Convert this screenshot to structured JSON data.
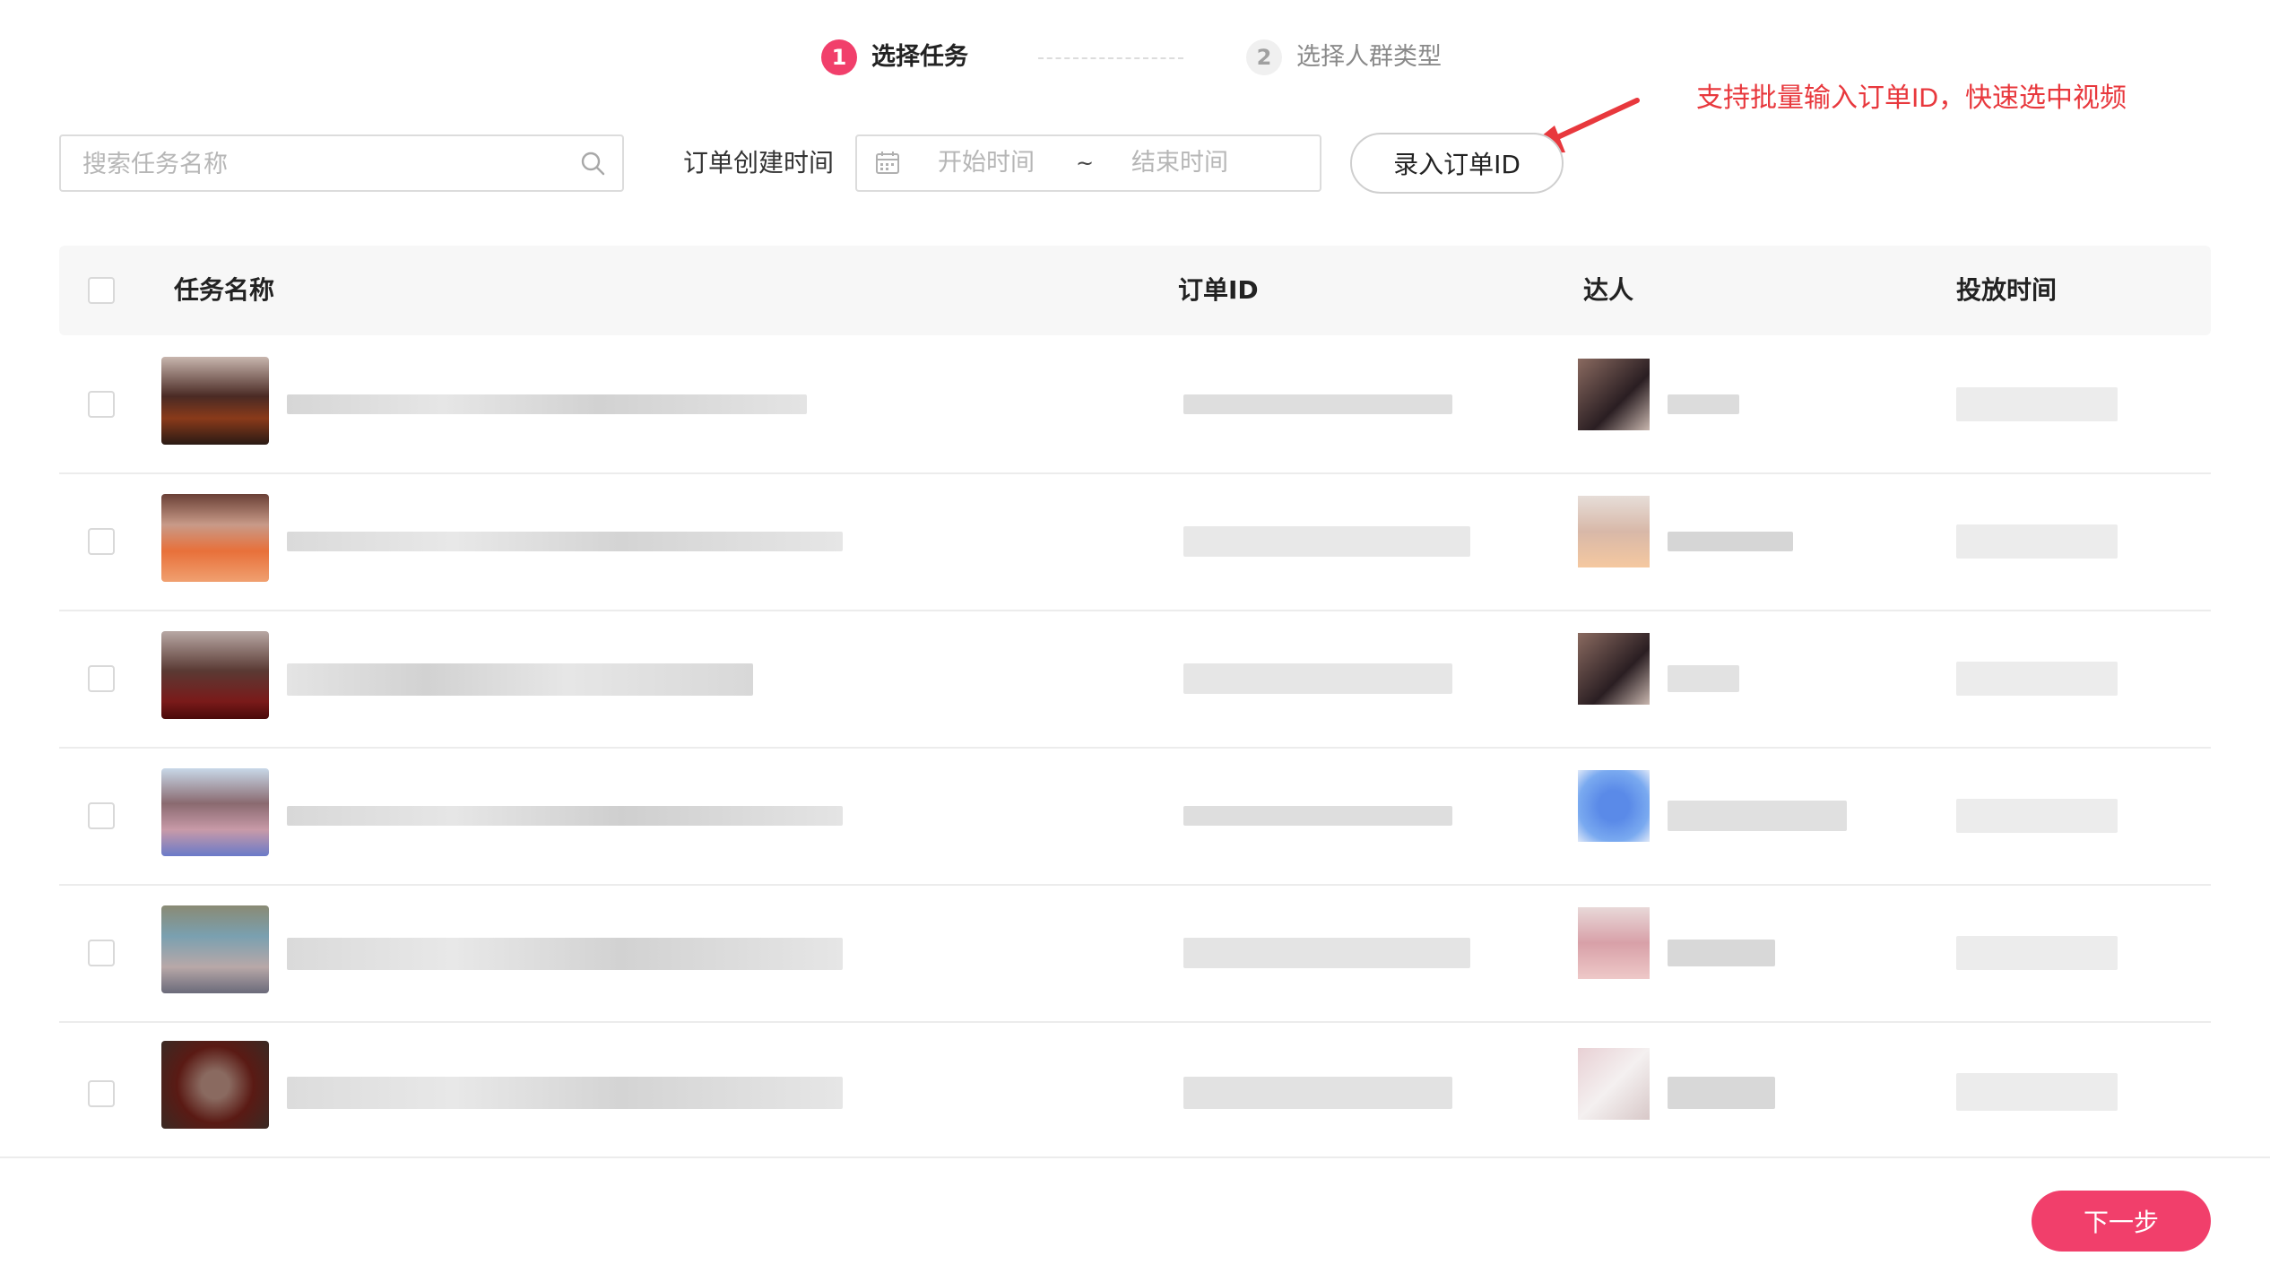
{
  "steps": [
    {
      "number": "1",
      "label": "选择任务"
    },
    {
      "number": "2",
      "label": "选择人群类型"
    }
  ],
  "annotation": "支持批量输入订单ID，快速选中视频",
  "search": {
    "placeholder": "搜索任务名称",
    "value": ""
  },
  "filter": {
    "label": "订单创建时间",
    "start_placeholder": "开始时间",
    "separator": "~",
    "end_placeholder": "结束时间"
  },
  "order_button": "录入订单ID",
  "table": {
    "columns": [
      "任务名称",
      "订单ID",
      "达人",
      "投放时间"
    ],
    "rows": [
      {
        "task": "",
        "order_id": "",
        "creator": "",
        "time": ""
      },
      {
        "task": "",
        "order_id": "",
        "creator": "",
        "time": ""
      },
      {
        "task": "",
        "order_id": "",
        "creator": "",
        "time": ""
      },
      {
        "task": "",
        "order_id": "",
        "creator": "",
        "time": ""
      },
      {
        "task": "",
        "order_id": "",
        "creator": "",
        "time": ""
      },
      {
        "task": "",
        "order_id": "",
        "creator": "",
        "time": ""
      }
    ]
  },
  "next_button": "下一步",
  "colors": {
    "accent": "#f13f6b",
    "annotation": "#e8383d",
    "header_bg": "#f7f7f7"
  }
}
